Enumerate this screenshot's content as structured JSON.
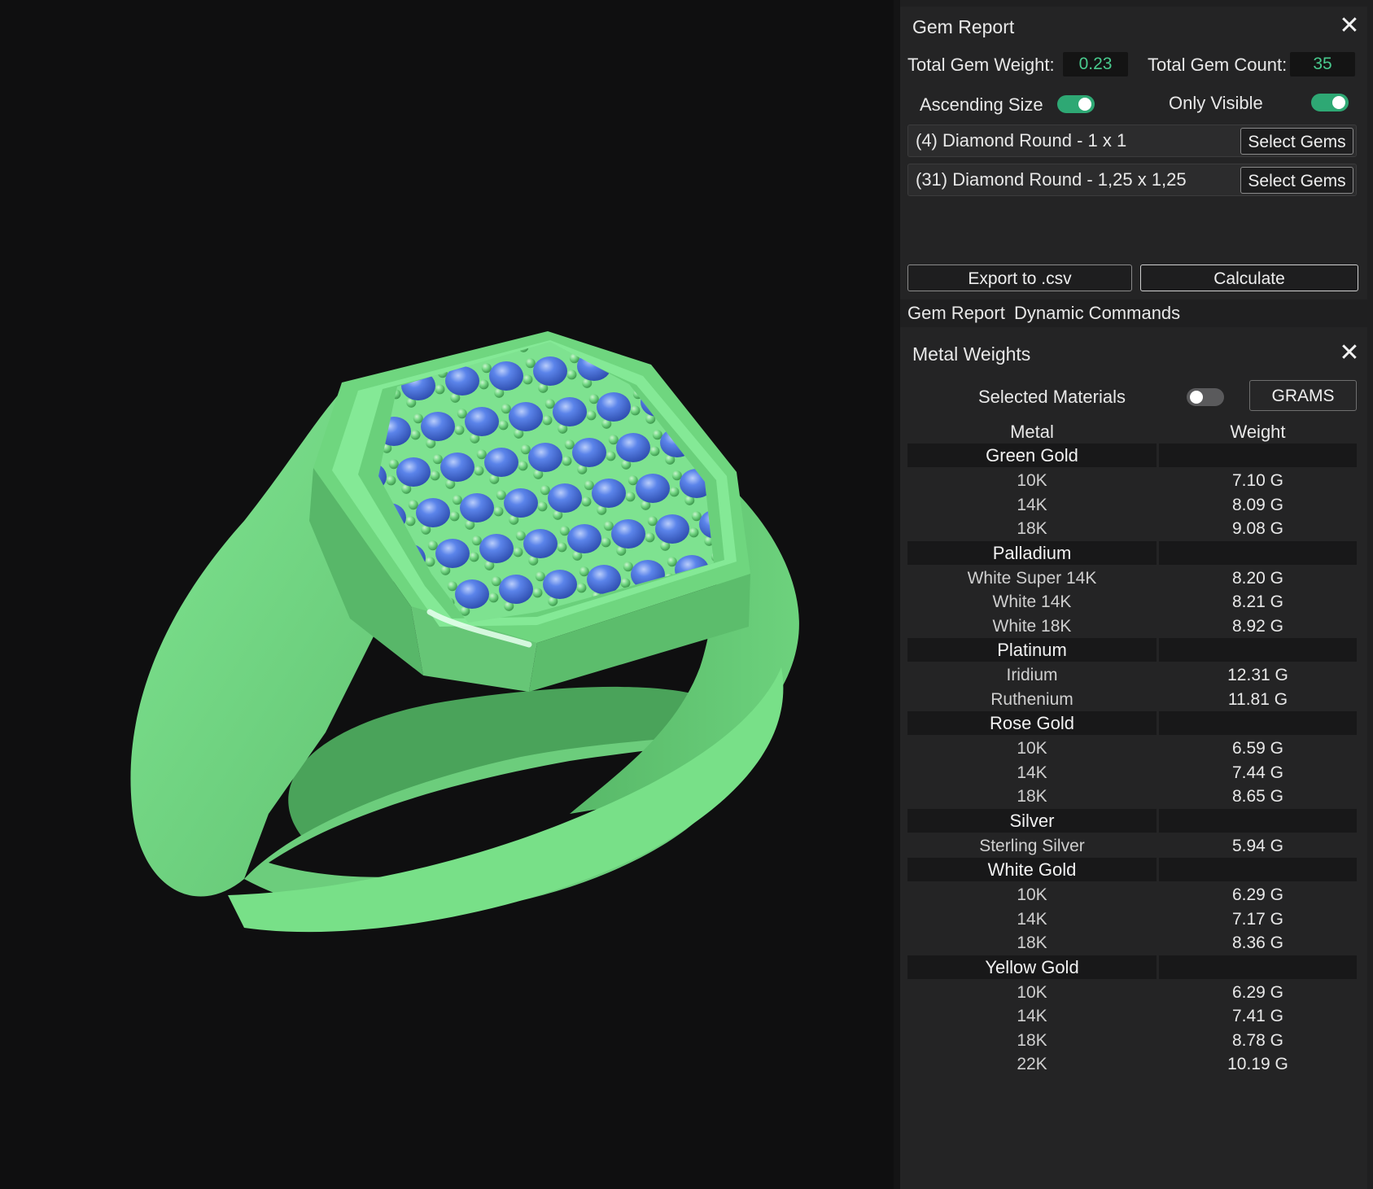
{
  "gem_report": {
    "title": "Gem Report",
    "total_weight_label": "Total Gem Weight:",
    "total_weight_value": "0.23",
    "total_count_label": "Total Gem Count:",
    "total_count_value": "35",
    "ascending_label": "Ascending Size",
    "ascending_on": true,
    "only_visible_label": "Only Visible",
    "only_visible_on": true,
    "gems": [
      {
        "label": "(4) Diamond Round - 1 x 1",
        "button": "Select Gems"
      },
      {
        "label": "(31) Diamond Round - 1,25 x 1,25",
        "button": "Select Gems"
      }
    ],
    "export_label": "Export to .csv",
    "calculate_label": "Calculate"
  },
  "tabs": [
    "Gem Report",
    "Dynamic Commands"
  ],
  "metal_weights": {
    "title": "Metal Weights",
    "selected_materials_label": "Selected Materials",
    "selected_materials_on": false,
    "unit_button": "GRAMS",
    "col_metal": "Metal",
    "col_weight": "Weight",
    "groups": [
      {
        "name": "Green Gold",
        "items": [
          [
            "10K",
            "7.10 G"
          ],
          [
            "14K",
            "8.09 G"
          ],
          [
            "18K",
            "9.08 G"
          ]
        ]
      },
      {
        "name": "Palladium",
        "items": [
          [
            "White Super 14K",
            "8.20 G"
          ],
          [
            "White 14K",
            "8.21 G"
          ],
          [
            "White 18K",
            "8.92 G"
          ]
        ]
      },
      {
        "name": "Platinum",
        "items": [
          [
            "Iridium",
            "12.31 G"
          ],
          [
            "Ruthenium",
            "11.81 G"
          ]
        ]
      },
      {
        "name": "Rose Gold",
        "items": [
          [
            "10K",
            "6.59 G"
          ],
          [
            "14K",
            "7.44 G"
          ],
          [
            "18K",
            "8.65 G"
          ]
        ]
      },
      {
        "name": "Silver",
        "items": [
          [
            "Sterling Silver",
            "5.94 G"
          ]
        ]
      },
      {
        "name": "White Gold",
        "items": [
          [
            "10K",
            "6.29 G"
          ],
          [
            "14K",
            "7.17 G"
          ],
          [
            "18K",
            "8.36 G"
          ]
        ]
      },
      {
        "name": "Yellow Gold",
        "items": [
          [
            "10K",
            "6.29 G"
          ],
          [
            "14K",
            "7.41 G"
          ],
          [
            "18K",
            "8.78 G"
          ],
          [
            "22K",
            "10.19 G"
          ]
        ]
      }
    ]
  },
  "colors": {
    "metal": "#74dc85",
    "gem": "#4f79e0",
    "accent": "#2ea874",
    "value_text": "#49c98d"
  }
}
